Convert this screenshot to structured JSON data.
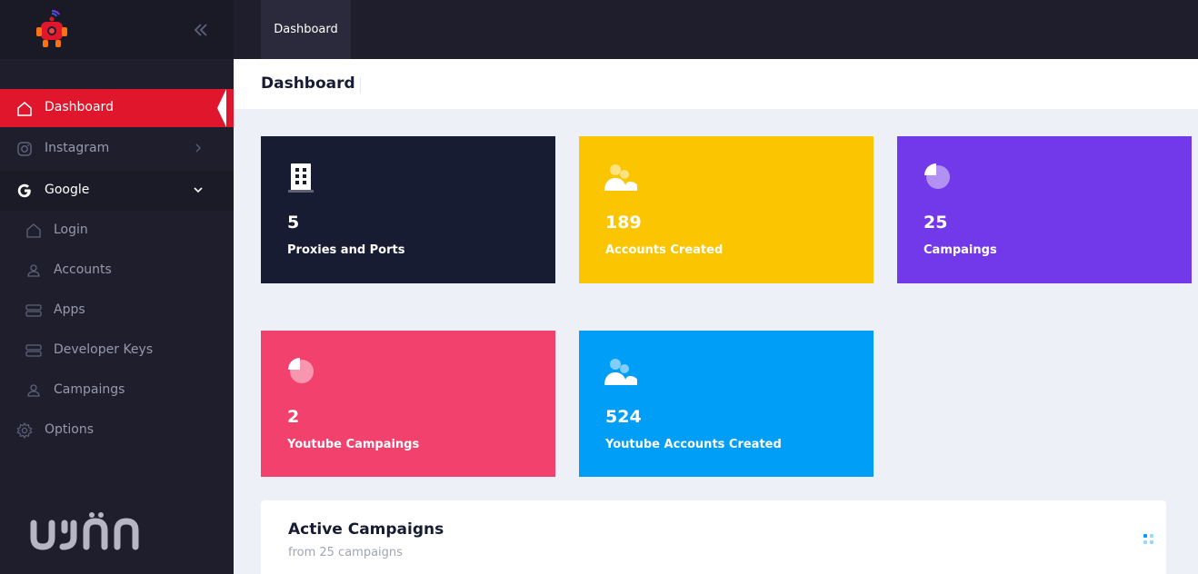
{
  "topbar": {
    "tab_label": "Dashboard"
  },
  "subheader": {
    "title": "Dashboard"
  },
  "sidebar": {
    "items": [
      {
        "label": "Dashboard",
        "icon": "home-icon"
      },
      {
        "label": "Instagram",
        "icon": "instagram-icon"
      },
      {
        "label": "Google",
        "icon": "google-icon"
      },
      {
        "label": "Login",
        "icon": "home-icon"
      },
      {
        "label": "Accounts",
        "icon": "user-icon"
      },
      {
        "label": "Apps",
        "icon": "server-icon"
      },
      {
        "label": "Developer Keys",
        "icon": "server-icon"
      },
      {
        "label": "Campaings",
        "icon": "user-icon"
      },
      {
        "label": "Options",
        "icon": "gear-icon"
      }
    ]
  },
  "stats": [
    {
      "value": "5",
      "label": "Proxies and Ports",
      "color": "#181c32",
      "icon": "building-icon"
    },
    {
      "value": "189",
      "label": "Accounts Created",
      "color": "#fbc601",
      "icon": "users-icon"
    },
    {
      "value": "25",
      "label": "Campaings",
      "color": "#7239ea",
      "icon": "pie-chart-icon"
    },
    {
      "value": "2",
      "label": "Youtube Campaings",
      "color": "#f1416c",
      "icon": "pie-chart-icon"
    },
    {
      "value": "524",
      "label": "Youtube Accounts Created",
      "color": "#009ef7",
      "icon": "users-icon"
    }
  ],
  "active_campaigns": {
    "title": "Active Campaigns",
    "subtitle": "from 25 campaigns"
  },
  "colors": {
    "accent": "#e0172c",
    "sidebar_bg": "#1e1e2d"
  }
}
